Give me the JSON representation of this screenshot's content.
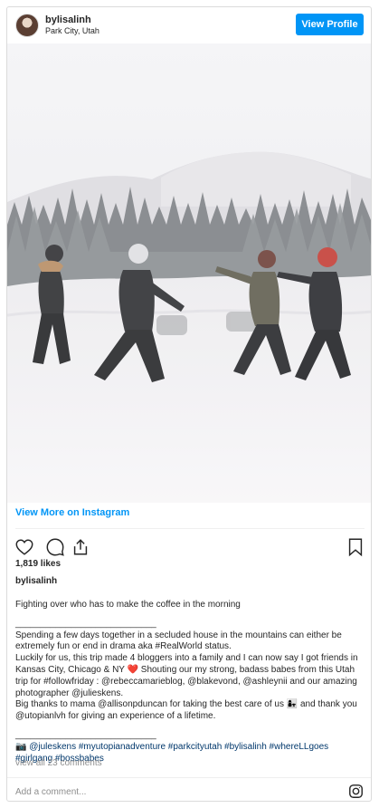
{
  "header": {
    "username": "bylisalinh",
    "location": "Park City, Utah",
    "view_profile_label": "View Profile"
  },
  "post": {
    "view_more_label": "View More on Instagram",
    "likes": "1,819 likes",
    "caption_username": "bylisalinh",
    "caption_lines": [
      "Fighting over who has to make the coffee in the morning",
      "____________________________",
      "Spending a few days together in a secluded house in the mountains can either be extremely fun or end in drama aka #RealWorld status.",
      "Luckily for us, this trip made 4 bloggers into a family and I can now say I got friends in Kansas City, Chicago & NY ❤️ Shouting our my strong, badass babes from this Utah trip for #followfriday : @rebeccamarieblog, @blakevond, @ashleynii and our amazing photographer @julieskens.",
      "Big thanks to mama @allisonpduncan for taking the best care of us 👩‍👧 and thank you @utopianlvh for giving an experience of a lifetime.",
      "____________________________",
      "📷 @juleskens #myutopianadventure #parkcityutah #bylisalinh #whereLLgoes #girlgang #bossbabes"
    ],
    "view_comments_label": "view all 23 comments",
    "comment_placeholder": "Add a comment..."
  },
  "icons": {
    "like": "heart-icon",
    "comment": "comment-icon",
    "share": "share-icon",
    "save": "bookmark-icon",
    "instagram": "instagram-icon"
  },
  "colors": {
    "accent": "#0095f6",
    "text": "#262626",
    "muted": "#8e8e8e",
    "link": "#00376b"
  }
}
